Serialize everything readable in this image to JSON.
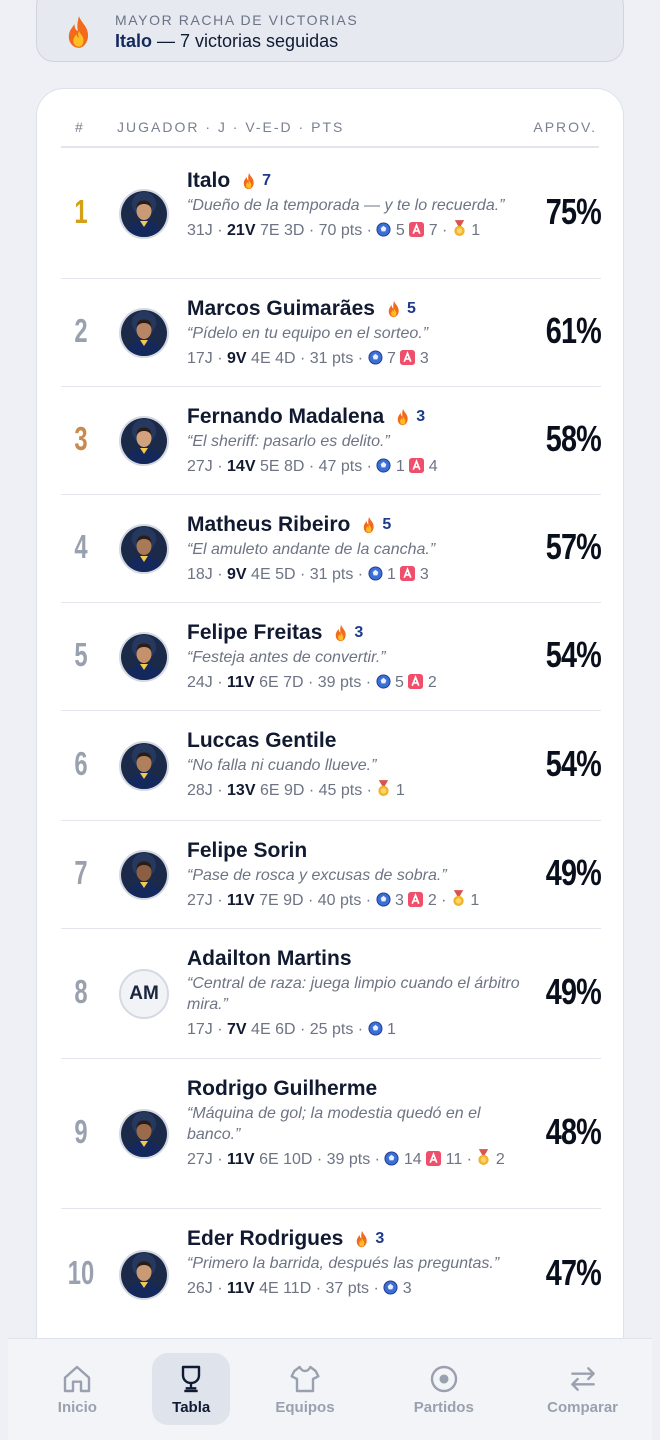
{
  "streak_banner": {
    "caption": "MAYOR RACHA DE VICTORIAS",
    "player": "Italo",
    "text": " — 7 victorias seguidas",
    "icon": "fire-icon"
  },
  "table": {
    "headers": {
      "rank": "#",
      "player": "JUGADOR · J · V-E-D · PTS",
      "pct": "APROV."
    },
    "rows": [
      {
        "rank": "1",
        "name": "Italo",
        "streak": "7",
        "quote": "“Dueño de la temporada — y te lo recuerda.”",
        "pj": "31J",
        "wins": "21V",
        "rest": "7E 3D · 70 pts",
        "goals": "5",
        "assists": "7",
        "mvp": "1",
        "pct": "75%"
      },
      {
        "rank": "2",
        "name": "Marcos Guimarães",
        "streak": "5",
        "quote": "“Pídelo en tu equipo en el sorteo.”",
        "pj": "17J",
        "wins": "9V",
        "rest": "4E 4D · 31 pts",
        "goals": "7",
        "assists": "3",
        "pct": "61%"
      },
      {
        "rank": "3",
        "name": "Fernando Madalena",
        "streak": "3",
        "quote": "“El sheriff: pasarlo es delito.”",
        "pj": "27J",
        "wins": "14V",
        "rest": "5E 8D · 47 pts",
        "goals": "1",
        "assists": "4",
        "pct": "58%"
      },
      {
        "rank": "4",
        "name": "Matheus Ribeiro",
        "streak": "5",
        "quote": "“El amuleto andante de la cancha.”",
        "pj": "18J",
        "wins": "9V",
        "rest": "4E 5D · 31 pts",
        "goals": "1",
        "assists": "3",
        "pct": "57%"
      },
      {
        "rank": "5",
        "name": "Felipe Freitas",
        "streak": "3",
        "quote": "“Festeja antes de convertir.”",
        "pj": "24J",
        "wins": "11V",
        "rest": "6E 7D · 39 pts",
        "goals": "5",
        "assists": "2",
        "pct": "54%"
      },
      {
        "rank": "6",
        "name": "Luccas Gentile",
        "quote": "“No falla ni cuando llueve.”",
        "pj": "28J",
        "wins": "13V",
        "rest": "6E 9D · 45 pts",
        "mvp": "1",
        "pct": "54%"
      },
      {
        "rank": "7",
        "name": "Felipe Sorin",
        "quote": "“Pase de rosca y excusas de sobra.”",
        "pj": "27J",
        "wins": "11V",
        "rest": "7E 9D · 40 pts",
        "goals": "3",
        "assists": "2",
        "mvp": "1",
        "pct": "49%"
      },
      {
        "rank": "8",
        "name": "Adailton Martins",
        "initials": "AM",
        "quote": "“Central de raza: juega limpio cuando el árbitro mira.”",
        "pj": "17J",
        "wins": "7V",
        "rest": "4E 6D · 25 pts",
        "goals": "1",
        "pct": "49%"
      },
      {
        "rank": "9",
        "name": "Rodrigo Guilherme",
        "quote": "“Máquina de gol; la modestia quedó en el banco.”",
        "pj": "27J",
        "wins": "11V",
        "rest": "6E 10D · 39 pts",
        "goals": "14",
        "assists": "11",
        "mvp": "2",
        "pct": "48%"
      },
      {
        "rank": "10",
        "name": "Eder Rodrigues",
        "streak": "3",
        "quote": "“Primero la barrida, después las preguntas.”",
        "pj": "26J",
        "wins": "11V",
        "rest": "4E 11D · 37 pts",
        "goals": "3",
        "pct": "47%"
      }
    ]
  },
  "colors": {
    "gold": "#d4a017",
    "bronze": "#c98a4b",
    "silver": "#9aa1ae",
    "accent": "#1e3a8a"
  },
  "nav": {
    "items": [
      {
        "label": "Inicio",
        "icon": "home-icon"
      },
      {
        "label": "Tabla",
        "icon": "trophy-icon",
        "active": true
      },
      {
        "label": "Equipos",
        "icon": "shirt-icon"
      },
      {
        "label": "Partidos",
        "icon": "ball-icon"
      },
      {
        "label": "Comparar",
        "icon": "swap-icon"
      }
    ]
  }
}
